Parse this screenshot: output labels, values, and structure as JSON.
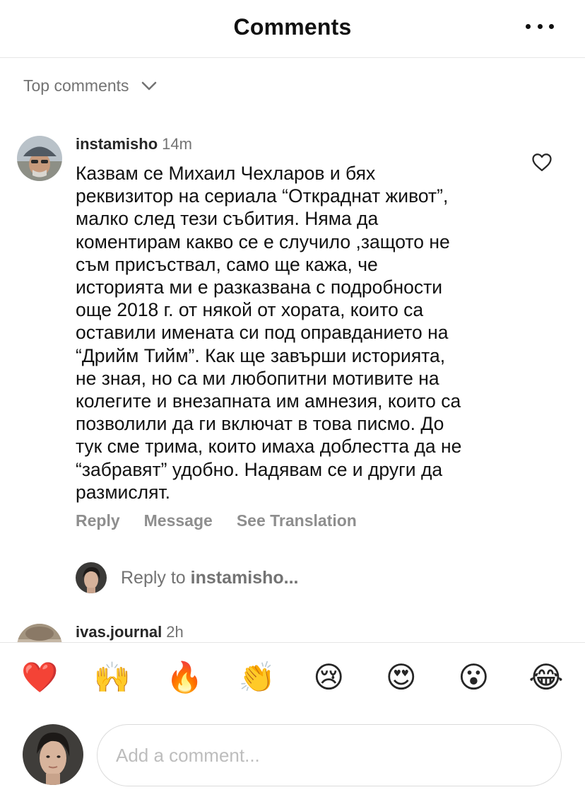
{
  "header": {
    "title": "Comments",
    "more_icon": "more-horizontal-icon"
  },
  "sort": {
    "label": "Top comments",
    "icon": "chevron-down-icon"
  },
  "comments": [
    {
      "username": "instamisho",
      "time": "14m",
      "text": "Казвам се Михаил Чехларов и бях\nреквизитор на сериала “Откраднат живот”,\nмалко след тези събития. Няма да\nкоментирам какво се е случило ,защото не\nсъм присъствал, само ще кажа, че\nисторията ми е разказвана с подробности\nоще 2018 г. от някой от хората, които са\nоставили имената си под оправданието на\n“Дрийм Тийм”. Как ще завърши историята,\nне зная, но са ми любопитни мотивите на\nколегите и внезапната им амнезия, които са\nпозволили да ги включат в това писмо. До\nтук сме трима, които имаха доблестта да не\n“забравят” удобно. Надявам се и други да\nразмислят.",
      "actions": {
        "reply": "Reply",
        "message": "Message",
        "translate": "See Translation"
      },
      "reply_prompt": {
        "prefix": "Reply to ",
        "username": "instamisho..."
      }
    },
    {
      "username": "ivas.journal",
      "time": "2h"
    }
  ],
  "emoji_bar": [
    "❤️",
    "🙌",
    "🔥",
    "👏",
    "😢",
    "😍",
    "😮",
    "😂"
  ],
  "composer": {
    "placeholder": "Add a comment..."
  },
  "colors": {
    "text": "#262626",
    "muted": "#737373",
    "action": "#8e8e8e",
    "border": "#dbdbdb"
  }
}
